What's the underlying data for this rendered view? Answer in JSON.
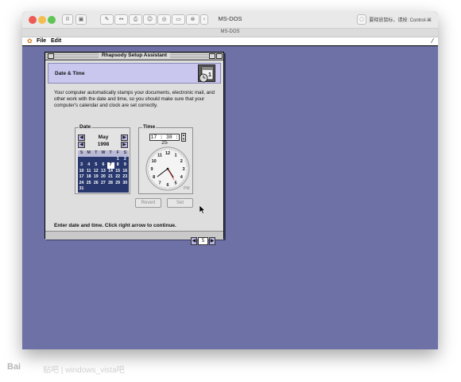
{
  "host": {
    "title": "MS-DOS",
    "subtitle": "MS-DOS",
    "right_label": "要释放鼠标，请按: Control-⌘",
    "toolbar_icons": [
      "pause-icon",
      "screenshot-icon",
      "wrench-icon",
      "arrows-icon",
      "printer-icon",
      "user-icon",
      "cd-icon",
      "disk-icon",
      "network-icon",
      "back-icon"
    ]
  },
  "menubar": {
    "items": [
      "File",
      "Edit"
    ],
    "right_glyph": "⁄"
  },
  "assistant": {
    "window_title": "Rhapsody Setup Assistant",
    "header_title": "Date & Time",
    "description": "Your computer automatically stamps your documents, electronic mail, and other work with the date and time, so you should make sure that your computer's calendar and clock are set correctly.",
    "date": {
      "group_label": "Date",
      "month": "May",
      "year": "1998",
      "weekdays": [
        "S",
        "M",
        "T",
        "W",
        "T",
        "F",
        "S"
      ],
      "weeks": [
        [
          "",
          "",
          "",
          "",
          "",
          "1",
          "2"
        ],
        [
          "3",
          "4",
          "5",
          "6",
          "7",
          "8",
          "9"
        ],
        [
          "10",
          "11",
          "12",
          "13",
          "14",
          "15",
          "16"
        ],
        [
          "17",
          "18",
          "19",
          "20",
          "21",
          "22",
          "23"
        ],
        [
          "24",
          "25",
          "26",
          "27",
          "28",
          "29",
          "30"
        ],
        [
          "31",
          "",
          "",
          "",
          "",
          "",
          ""
        ]
      ],
      "selected_day": "7"
    },
    "time": {
      "group_label": "Time",
      "value": "17 : 38 : 25",
      "clock_numbers": [
        "12",
        "1",
        "2",
        "3",
        "4",
        "5",
        "6",
        "7",
        "8",
        "9",
        "10",
        "11"
      ],
      "meridiem": "PM"
    },
    "buttons": {
      "revert": "Revert",
      "set": "Set"
    },
    "instruction": "Enter date and time.  Click right arrow to continue.",
    "page_number": "5"
  },
  "watermark": {
    "brand": "Bai",
    "rest": "贴吧 | windows_vista吧"
  }
}
